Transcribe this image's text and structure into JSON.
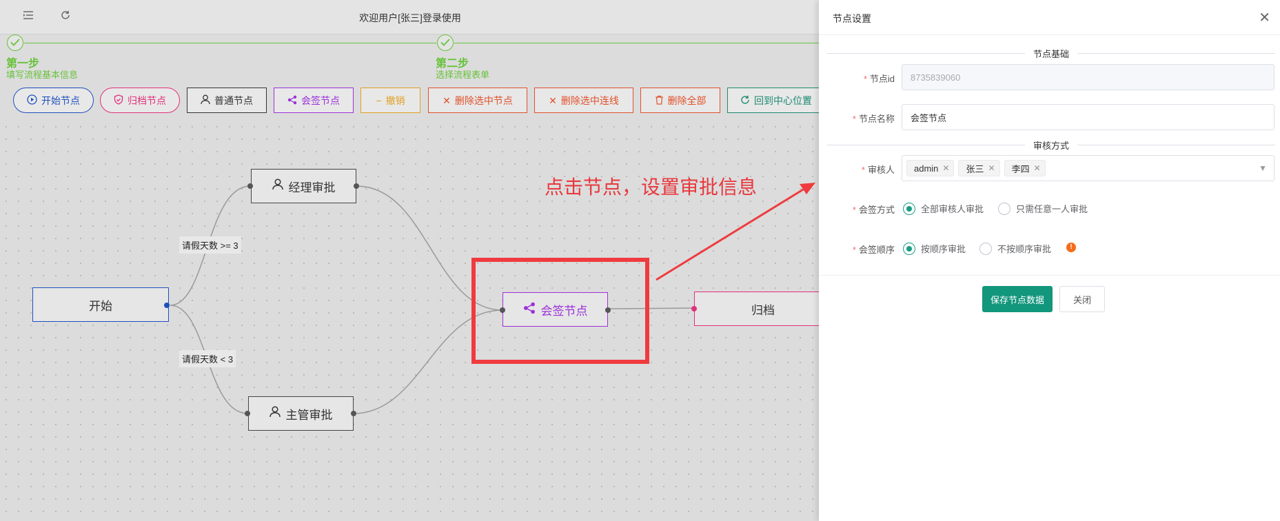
{
  "header": {
    "title": "欢迎用户[张三]登录使用",
    "menu_icon": "menu-fold-icon",
    "refresh_icon": "refresh-icon"
  },
  "steps": [
    {
      "title": "第一步",
      "desc": "填写流程基本信息"
    },
    {
      "title": "第二步",
      "desc": "选择流程表单"
    }
  ],
  "toolbar": {
    "start": "开始节点",
    "archive": "归档节点",
    "normal": "普通节点",
    "countersign": "会签节点",
    "undo": "撤销",
    "delete_node": "删除选中节点",
    "delete_edge": "删除选中连线",
    "delete_all": "删除全部",
    "center": "回到中心位置"
  },
  "canvas": {
    "nodes": {
      "start": "开始",
      "manager": "经理审批",
      "supervisor": "主管审批",
      "countersign": "会签节点",
      "archive": "归档"
    },
    "edge_labels": {
      "ge3": "请假天数 >= 3",
      "lt3": "请假天数 < 3"
    },
    "annotation": "点击节点，设置审批信息"
  },
  "drawer": {
    "title": "节点设置",
    "section_basic": "节点基础",
    "node_id_label": "节点id",
    "node_id_value": "8735839060",
    "node_name_label": "节点名称",
    "node_name_value": "会签节点",
    "section_review": "审核方式",
    "reviewer_label": "审核人",
    "reviewers": [
      "admin",
      "张三",
      "李四"
    ],
    "sign_mode_label": "会签方式",
    "sign_mode_options": [
      "全部审核人审批",
      "只需任意一人审批"
    ],
    "sign_mode_selected": 0,
    "sign_order_label": "会签顺序",
    "sign_order_options": [
      "按顺序审批",
      "不按顺序审批"
    ],
    "sign_order_selected": 0,
    "save_button": "保存节点数据",
    "close_button": "关闭"
  },
  "colors": {
    "start": "#1f4fbf",
    "archive": "#e0307a",
    "normal": "#333333",
    "countersign": "#9b30d9",
    "undo": "#e0a020",
    "delete": "#e0502a",
    "center": "#1b8a70",
    "primary": "#12967c",
    "annotation": "#e8383d"
  }
}
